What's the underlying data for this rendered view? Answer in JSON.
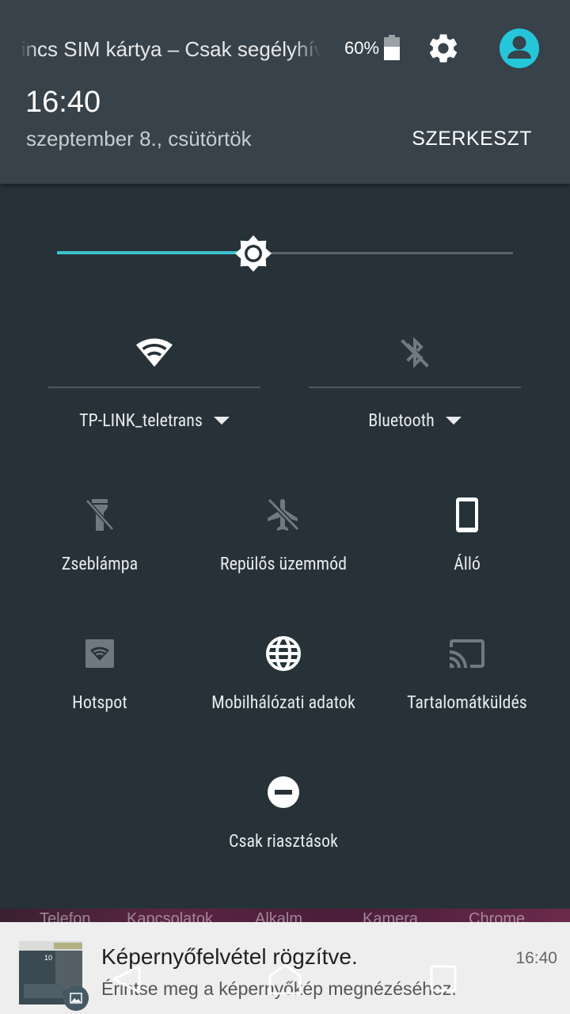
{
  "status": {
    "carrier_text": "Nincs SIM kártya – Csak segélyhívás",
    "battery_percent": "60%",
    "battery_level": 0.6
  },
  "header": {
    "time": "16:40",
    "date": "szeptember 8., csütörtök",
    "edit_label": "SZERKESZT"
  },
  "brightness": {
    "level": 0.43
  },
  "wifi": {
    "icon": "wifi-icon",
    "label": "TP-LINK_teletrans",
    "enabled": true
  },
  "bluetooth": {
    "icon": "bluetooth-disabled-icon",
    "label": "Bluetooth",
    "enabled": false
  },
  "tiles": [
    {
      "label": "Zseblámpa",
      "icon": "flashlight-off-icon",
      "active": false
    },
    {
      "label": "Repülős üzemmód",
      "icon": "airplane-off-icon",
      "active": false
    },
    {
      "label": "Álló",
      "icon": "portrait-phone-icon",
      "active": true
    },
    {
      "label": "Hotspot",
      "icon": "hotspot-icon",
      "active": false
    },
    {
      "label": "Mobilhálózati adatok",
      "icon": "globe-icon",
      "active": true
    },
    {
      "label": "Tartalomátküldés",
      "icon": "cast-icon",
      "active": false
    },
    {
      "label": "Csak riasztások",
      "icon": "do-not-disturb-icon",
      "active": true
    }
  ],
  "home_apps": [
    "Telefon",
    "Kapcsolatok",
    "Alkalm.",
    "Kamera",
    "Chrome"
  ],
  "notification": {
    "title": "Képernyőfelvétel rögzítve.",
    "text": "Érintse meg a képernyőkép megnézéséhez.",
    "time": "16:40"
  },
  "colors": {
    "accent": "#3ec1cf",
    "panel_bg": "#263238",
    "header_bg": "#37424a",
    "inactive_icon": "#6f7a80"
  }
}
